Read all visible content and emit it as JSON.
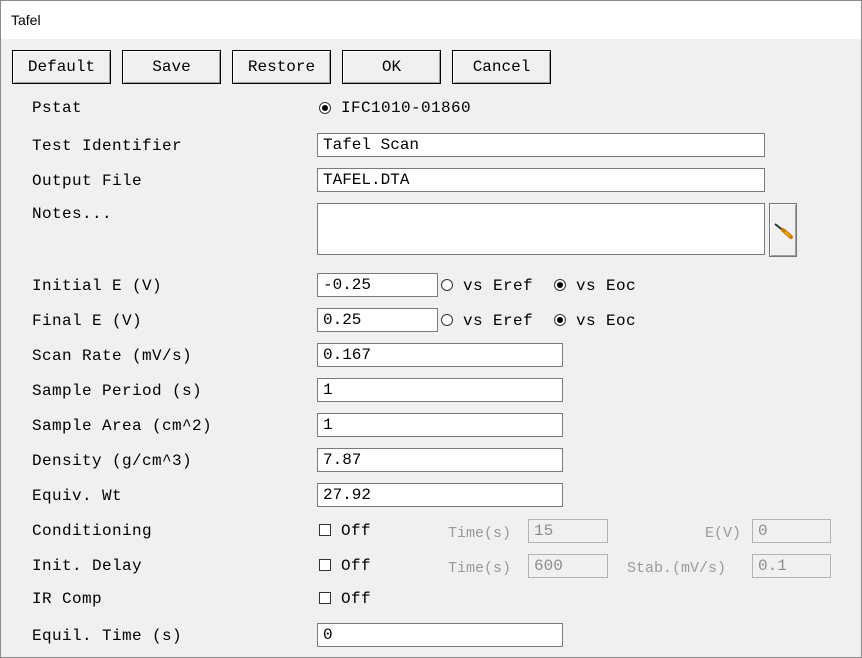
{
  "window": {
    "title": "Tafel"
  },
  "toolbar": {
    "default_label": "Default",
    "save_label": "Save",
    "restore_label": "Restore",
    "ok_label": "OK",
    "cancel_label": "Cancel"
  },
  "form": {
    "pstat": {
      "label": "Pstat",
      "option": "IFC1010-01860",
      "selected": true
    },
    "test_identifier": {
      "label": "Test Identifier",
      "value": "Tafel Scan"
    },
    "output_file": {
      "label": "Output File",
      "value": "TAFEL.DTA"
    },
    "notes": {
      "label": "Notes...",
      "value": "",
      "edit_icon": "screwdriver-icon"
    },
    "initial_e": {
      "label": "Initial E (V)",
      "value": "-0.25",
      "opt_eref": "vs Eref",
      "opt_eoc": "vs Eoc",
      "selected": "vs Eoc"
    },
    "final_e": {
      "label": "Final E (V)",
      "value": "0.25",
      "opt_eref": "vs Eref",
      "opt_eoc": "vs Eoc",
      "selected": "vs Eoc"
    },
    "scan_rate": {
      "label": "Scan Rate (mV/s)",
      "value": "0.167"
    },
    "sample_period": {
      "label": "Sample Period (s)",
      "value": "1"
    },
    "sample_area": {
      "label": "Sample Area (cm^2)",
      "value": "1"
    },
    "density": {
      "label": "Density (g/cm^3)",
      "value": "7.87"
    },
    "equiv_wt": {
      "label": "Equiv. Wt",
      "value": "27.92"
    },
    "conditioning": {
      "label": "Conditioning",
      "check_label": "Off",
      "checked": false,
      "time_label": "Time(s)",
      "time_value": "15",
      "e_label": "E(V)",
      "e_value": "0"
    },
    "init_delay": {
      "label": "Init. Delay",
      "check_label": "Off",
      "checked": false,
      "time_label": "Time(s)",
      "time_value": "600",
      "stab_label": "Stab.(mV/s)",
      "stab_value": "0.1"
    },
    "ir_comp": {
      "label": "IR Comp",
      "check_label": "Off",
      "checked": false
    },
    "equil_time": {
      "label": "Equil. Time (s)",
      "value": "0"
    }
  }
}
